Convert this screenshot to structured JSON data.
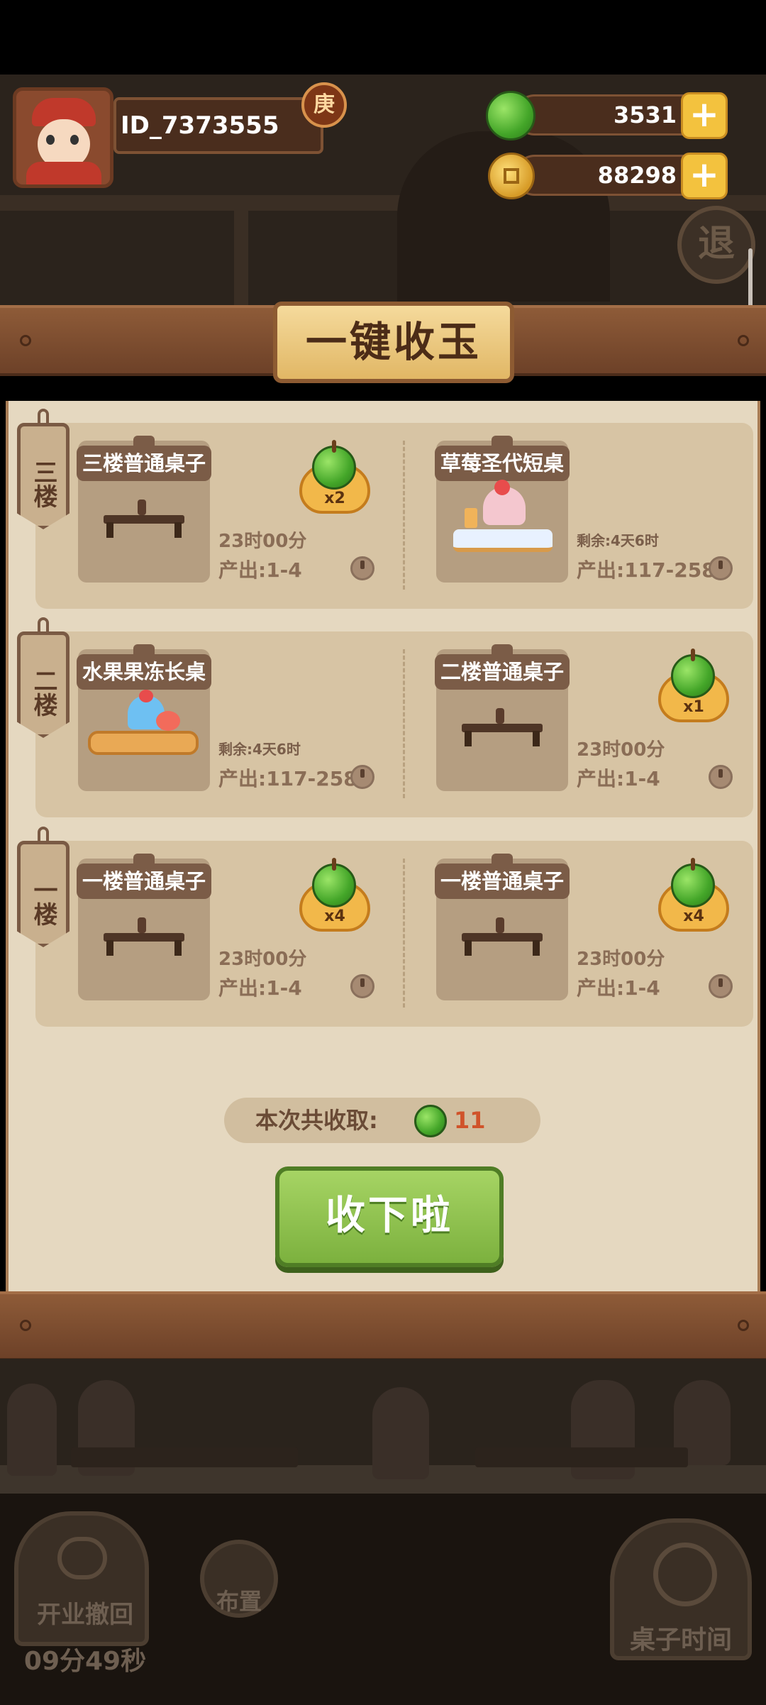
{
  "player": {
    "id": "ID_7373555",
    "rank_badge": "庚"
  },
  "resources": {
    "jade": {
      "value": "3531",
      "icon": "jade-icon"
    },
    "coins": {
      "value": "88298",
      "icon": "coin-icon"
    },
    "plus_symbol": "+"
  },
  "exit_button": {
    "label": "退"
  },
  "panel": {
    "title": "一键收玉",
    "floors": [
      {
        "label": "三楼",
        "tables": [
          {
            "name": "三楼普通桌子",
            "time": "23时00分",
            "output": "产出:1-4",
            "jade_badge": "x2"
          },
          {
            "name": "草莓圣代短桌",
            "remaining": "剩余:4天6时",
            "output": "产出:117-258"
          }
        ]
      },
      {
        "label": "二楼",
        "tables": [
          {
            "name": "水果果冻长桌",
            "remaining": "剩余:4天6时",
            "output": "产出:117-258"
          },
          {
            "name": "二楼普通桌子",
            "time": "23时00分",
            "output": "产出:1-4",
            "jade_badge": "x1"
          }
        ]
      },
      {
        "label": "一楼",
        "tables": [
          {
            "name": "一楼普通桌子",
            "time": "23时00分",
            "output": "产出:1-4",
            "jade_badge": "x4"
          },
          {
            "name": "一楼普通桌子",
            "time": "23时00分",
            "output": "产出:1-4",
            "jade_badge": "x4"
          }
        ]
      }
    ],
    "total_label": "本次共收取:",
    "total_value": "11",
    "collect_button": "收下啦"
  },
  "bottom_bar": {
    "undo_label": "开业撤回",
    "undo_timer": "09分49秒",
    "arrange_label": "布置",
    "table_time_label": "桌子时间"
  }
}
